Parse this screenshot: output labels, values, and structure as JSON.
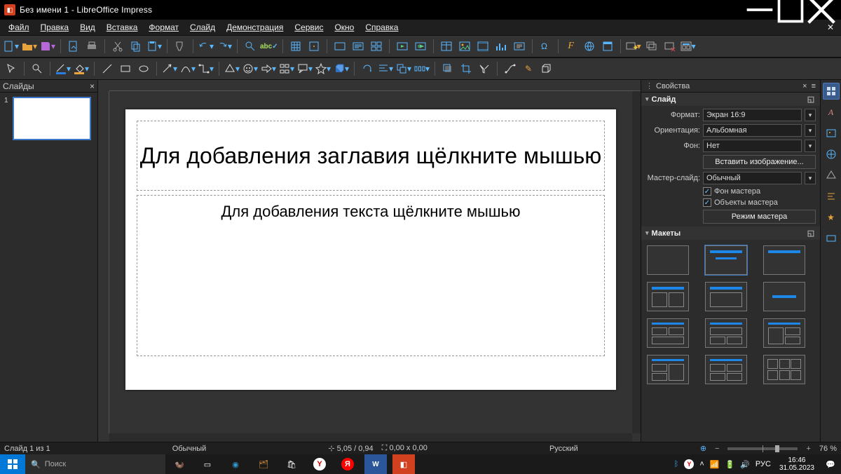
{
  "app": {
    "title": "Без имени 1 - LibreOffice Impress"
  },
  "menu": {
    "file": "Файл",
    "edit": "Правка",
    "view": "Вид",
    "insert": "Вставка",
    "format": "Формат",
    "slide": "Слайд",
    "demo": "Демонстрация",
    "service": "Сервис",
    "window": "Окно",
    "help": "Справка"
  },
  "slidesPanel": {
    "title": "Слайды",
    "thumbNum": "1"
  },
  "slide": {
    "titlePlaceholder": "Для добавления заглавия щёлкните мышью",
    "contentPlaceholder": "Для добавления текста щёлкните мышью"
  },
  "props": {
    "header": "Свойства",
    "section_slide": "Слайд",
    "format_lbl": "Формат:",
    "format_val": "Экран 16:9",
    "orient_lbl": "Ориентация:",
    "orient_val": "Альбомная",
    "bg_lbl": "Фон:",
    "bg_val": "Нет",
    "insert_image": "Вставить изображение...",
    "master_lbl": "Мастер-слайд:",
    "master_val": "Обычный",
    "master_bg": "Фон мастера",
    "master_obj": "Объекты мастера",
    "master_mode": "Режим мастера",
    "section_layouts": "Макеты"
  },
  "statusbar": {
    "slide": "Слайд 1 из 1",
    "style": "Обычный",
    "pos": "5,05 / 0,94",
    "size": "0,00 x 0,00",
    "lang": "Русский",
    "zoom": "76 %"
  },
  "taskbar": {
    "search": "Поиск",
    "lang": "РУС",
    "time": "16:46",
    "date": "31.05.2023"
  }
}
